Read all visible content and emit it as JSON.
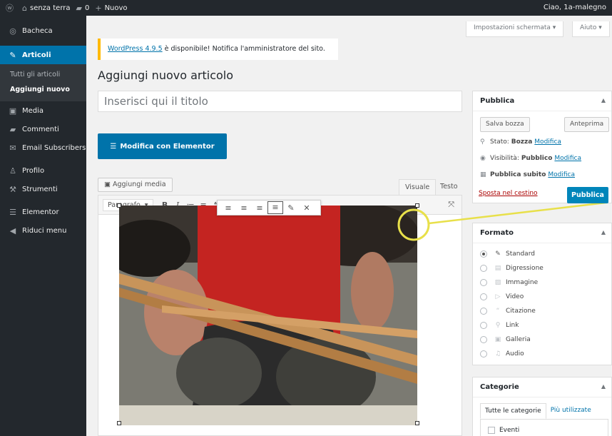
{
  "adminbar": {
    "site_name": "senza terra",
    "comments_count": "0",
    "new_label": "Nuovo",
    "greeting": "Ciao, 1a-malegno"
  },
  "sidebar": {
    "items": [
      {
        "label": "Bacheca",
        "icon": "dashboard-icon"
      },
      {
        "label": "Articoli",
        "icon": "pin-icon"
      },
      {
        "label": "Media",
        "icon": "media-icon"
      },
      {
        "label": "Commenti",
        "icon": "comment-icon"
      },
      {
        "label": "Email Subscribers",
        "icon": "email-icon"
      },
      {
        "label": "Profilo",
        "icon": "user-icon"
      },
      {
        "label": "Strumenti",
        "icon": "wrench-icon"
      },
      {
        "label": "Elementor",
        "icon": "elementor-icon"
      },
      {
        "label": "Riduci menu",
        "icon": "collapse-icon"
      }
    ],
    "submenu": [
      "Tutti gli articoli",
      "Aggiungi nuovo"
    ]
  },
  "screen_options": {
    "options_label": "Impostazioni schermata ▾",
    "help_label": "Aiuto ▾"
  },
  "notice": {
    "link": "WordPress 4.9.5",
    "text": " è disponibile! Notifica l'amministratore del sito."
  },
  "page_title": "Aggiungi nuovo articolo",
  "title_placeholder": "Inserisci qui il titolo",
  "elementor_button": "Modifica con Elementor",
  "add_media": "Aggiungi media",
  "editor_tabs": {
    "visual": "Visuale",
    "text": "Testo"
  },
  "toolbar": {
    "format": "Paragrafo"
  },
  "publish": {
    "title": "Pubblica",
    "save_draft": "Salva bozza",
    "preview": "Anteprima",
    "status_label": "Stato:",
    "status_value": "Bozza",
    "visibility_label": "Visibilità:",
    "visibility_value": "Pubblico",
    "schedule": "Pubblica subito",
    "edit_link": "Modifica",
    "trash": "Sposta nel cestino",
    "publish_button": "Pubblica"
  },
  "format": {
    "title": "Formato",
    "options": [
      "Standard",
      "Digressione",
      "Immagine",
      "Video",
      "Citazione",
      "Link",
      "Galleria",
      "Audio"
    ],
    "selected": "Standard"
  },
  "categories": {
    "title": "Categorie",
    "tab_all": "Tutte le categorie",
    "tab_popular": "Più utilizzate",
    "items": [
      "Eventi"
    ]
  },
  "colors": {
    "admin_bg": "#23282d",
    "accent": "#0073aa",
    "highlight": "#e8e04a"
  }
}
